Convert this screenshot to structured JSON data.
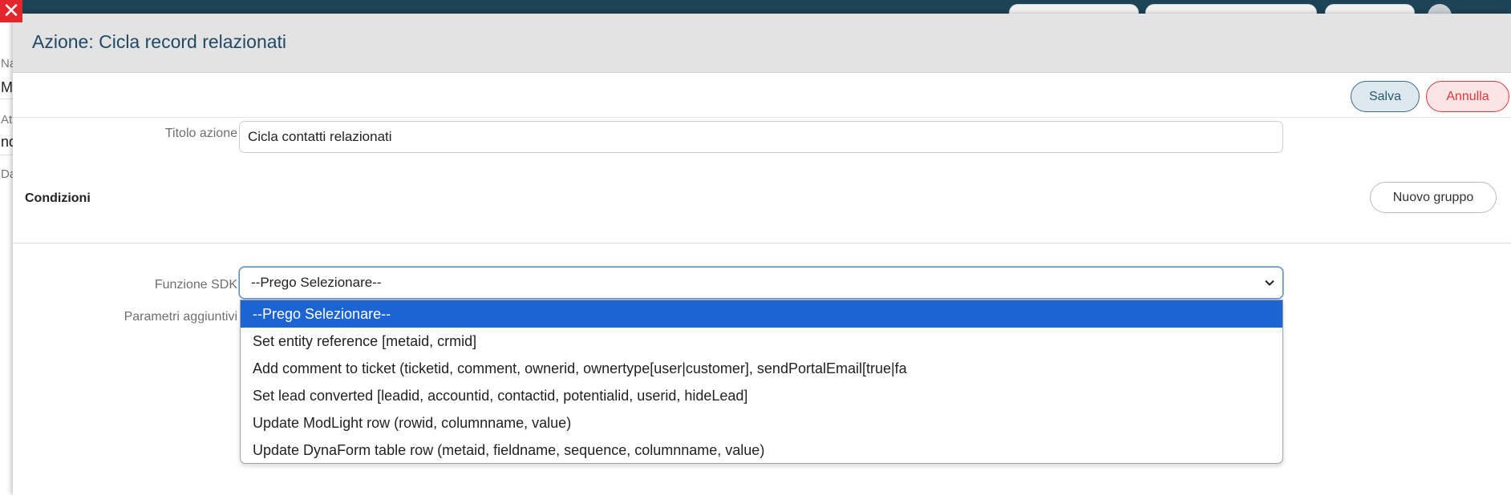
{
  "background": {
    "left_fragments": [
      "Na",
      "M",
      "At",
      "nd",
      "Da"
    ]
  },
  "modal": {
    "title": "Azione: Cicla record relazionati",
    "toolbar": {
      "save_label": "Salva",
      "cancel_label": "Annulla"
    },
    "form": {
      "action_title_label": "Titolo azione",
      "action_title_value": "Cicla contatti relazionati",
      "conditions_label": "Condizioni",
      "new_group_label": "Nuovo gruppo",
      "sdk_function_label": "Funzione SDK",
      "sdk_function_selected": "--Prego Selezionare--",
      "extra_params_label": "Parametri aggiuntivi"
    },
    "dropdown_options": [
      "--Prego Selezionare--",
      "Set entity reference [metaid, crmid]",
      "Add comment to ticket (ticketid, comment, ownerid, ownertype[user|customer], sendPortalEmail[true|fa",
      "Set lead converted [leadid, accountid, contactid, potentialid, userid, hideLead]",
      "Update ModLight row (rowid, columnname, value)",
      "Update DynaForm table row (metaid, fieldname, sequence, columnname, value)"
    ]
  },
  "colors": {
    "header_bg": "#e3e3e3",
    "title_text": "#1e4a66",
    "save_border": "#3d6a80",
    "cancel_red": "#e0363b",
    "selected_option": "#1d64d3",
    "close_red": "#e3262b"
  }
}
